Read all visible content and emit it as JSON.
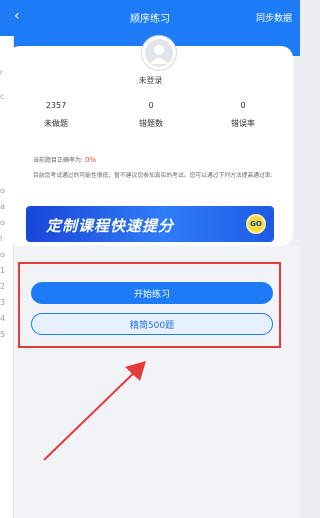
{
  "topbar": {
    "back_icon": "‹",
    "title": "顺序练习",
    "sync_label": "同步数据"
  },
  "profile": {
    "avatar_icon": "user-avatar-icon",
    "status": "未登录",
    "stats": [
      {
        "value": "2357",
        "label": "未做题"
      },
      {
        "value": "0",
        "label": "错题数"
      },
      {
        "value": "0",
        "label": "错误率"
      }
    ],
    "rate_label": "当前题目正确率为:",
    "rate_value": "0%",
    "notice": "目前您考试通过的可能性很低，暂不建议您参加真实的考试。您可以通过下列方法提高通过率:"
  },
  "banner": {
    "text": "定制课程快速提分",
    "go": "GO"
  },
  "actions": {
    "start_label": "开始练习",
    "selected_label": "精简500题"
  },
  "left_strip_chars": [
    "r",
    "c",
    "o",
    "a",
    "o",
    "l",
    "o",
    "1",
    "2",
    "3",
    "4",
    "5"
  ],
  "colors": {
    "primary": "#1d7cf5",
    "highlight": "#e53a3a",
    "rate": "#e24848"
  }
}
